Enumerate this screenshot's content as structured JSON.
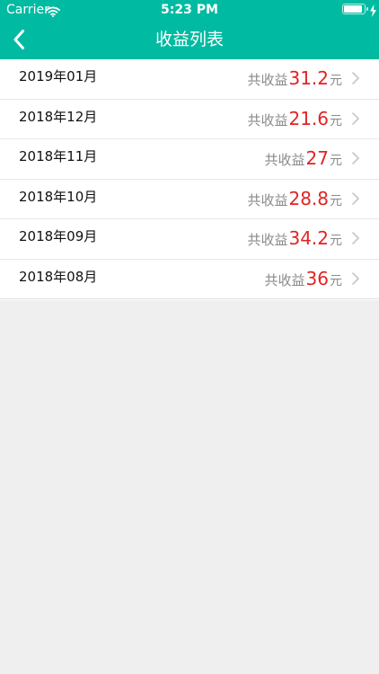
{
  "status": {
    "carrier": "Carrier",
    "time": "5:23 PM"
  },
  "header": {
    "title": "收益列表",
    "back_icon": "chevron-left-icon"
  },
  "list": [
    {
      "month": "2019年01月",
      "prefix": "共收益",
      "amount": "31.2",
      "unit": "元"
    },
    {
      "month": "2018年12月",
      "prefix": "共收益",
      "amount": "21.6",
      "unit": "元"
    },
    {
      "month": "2018年11月",
      "prefix": "共收益",
      "amount": "27",
      "unit": "元"
    },
    {
      "month": "2018年10月",
      "prefix": "共收益",
      "amount": "28.8",
      "unit": "元"
    },
    {
      "month": "2018年09月",
      "prefix": "共收益",
      "amount": "34.2",
      "unit": "元"
    },
    {
      "month": "2018年08月",
      "prefix": "共收益",
      "amount": "36",
      "unit": "元"
    }
  ],
  "colors": {
    "header": "#00bba2",
    "amount": "#e02424",
    "muted_text": "#8a8a8a",
    "background": "#efefef"
  }
}
